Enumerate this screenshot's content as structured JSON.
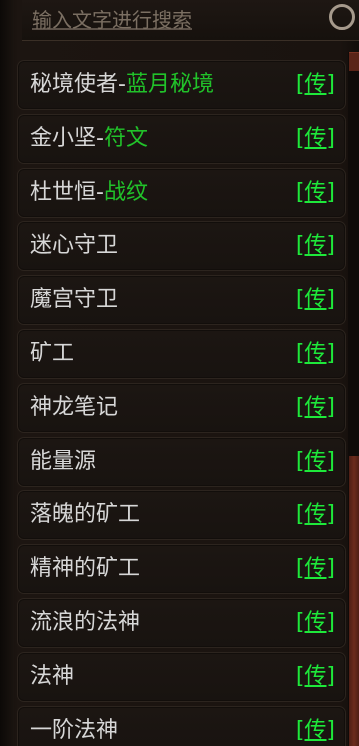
{
  "search": {
    "placeholder": "输入文字进行搜索"
  },
  "link_label": "[传]",
  "items": [
    {
      "name": "秘境使者",
      "sep": "-",
      "sub": "蓝月秘境"
    },
    {
      "name": "金小坚",
      "sep": "-",
      "sub": "符文"
    },
    {
      "name": "杜世恒",
      "sep": "-",
      "sub": "战纹"
    },
    {
      "name": "迷心守卫",
      "sep": "",
      "sub": ""
    },
    {
      "name": "魔宫守卫",
      "sep": "",
      "sub": ""
    },
    {
      "name": "矿工",
      "sep": "",
      "sub": ""
    },
    {
      "name": "神龙笔记",
      "sep": "",
      "sub": ""
    },
    {
      "name": "能量源",
      "sep": "",
      "sub": ""
    },
    {
      "name": "落魄的矿工",
      "sep": "",
      "sub": ""
    },
    {
      "name": "精神的矿工",
      "sep": "",
      "sub": ""
    },
    {
      "name": "流浪的法神",
      "sep": "",
      "sub": ""
    },
    {
      "name": "法神",
      "sep": "",
      "sub": ""
    },
    {
      "name": "一阶法神",
      "sep": "",
      "sub": ""
    }
  ],
  "colors": {
    "name_text": "#d7d7d7",
    "sub_text": "#21c22a",
    "link_text": "#1ee83a",
    "scrollbar": "#6b2b1c"
  }
}
